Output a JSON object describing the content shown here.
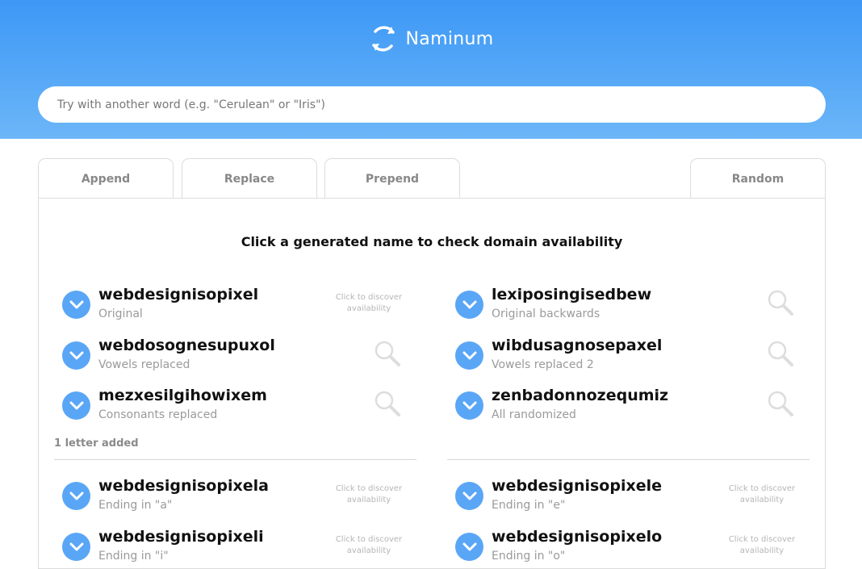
{
  "app": {
    "name": "Naminum"
  },
  "search": {
    "placeholder": "Try with another word (e.g. \"Cerulean\" or \"Iris\")"
  },
  "tabs": [
    {
      "label": "Append"
    },
    {
      "label": "Replace"
    },
    {
      "label": "Prepend"
    },
    {
      "label": "Random"
    }
  ],
  "panel": {
    "title": "Click a generated name to check domain availability"
  },
  "hint_text": "Click to discover availability",
  "names": [
    {
      "name": "webdesignisopixel",
      "desc": "Original"
    },
    {
      "name": "lexiposingisedbew",
      "desc": "Original backwards"
    },
    {
      "name": "webdosognesupuxol",
      "desc": "Vowels replaced"
    },
    {
      "name": "wibdusagnosepaxel",
      "desc": "Vowels replaced 2"
    },
    {
      "name": "mezxesilgihowixem",
      "desc": "Consonants replaced"
    },
    {
      "name": "zenbadonnozequmiz",
      "desc": "All randomized"
    }
  ],
  "section": {
    "label": "1 letter added"
  },
  "added": [
    {
      "name": "webdesignisopixela",
      "desc": "Ending in \"a\""
    },
    {
      "name": "webdesignisopixele",
      "desc": "Ending in \"e\""
    },
    {
      "name": "webdesignisopixeli",
      "desc": "Ending in \"i\""
    },
    {
      "name": "webdesignisopixelo",
      "desc": "Ending in \"o\""
    }
  ],
  "colors": {
    "header_top": "#3d98f6",
    "header_bottom": "#6cb6f8",
    "accent": "#5aa6f6"
  }
}
